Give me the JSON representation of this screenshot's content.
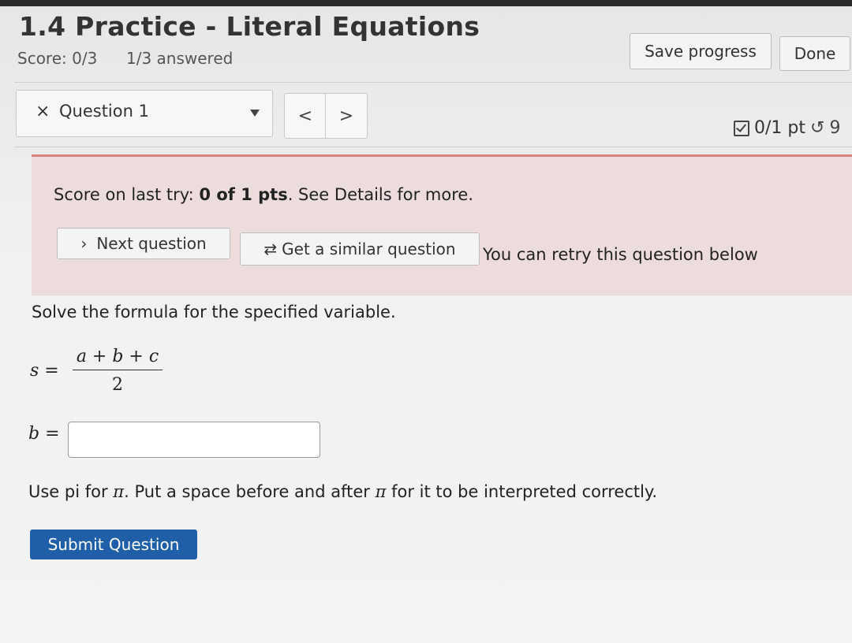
{
  "header": {
    "title": "1.4 Practice - Literal Equations",
    "score": "Score: 0/3",
    "answered": "1/3 answered",
    "save_label": "Save progress",
    "done_label": "Done"
  },
  "question_nav": {
    "close_glyph": "×",
    "current": "Question 1",
    "prev_glyph": "<",
    "next_glyph": ">",
    "points": "0/1 pt",
    "retry_glyph": "↺",
    "retry_count": "9"
  },
  "alert": {
    "prefix": "Score on last try: ",
    "score": "0 of 1 pts",
    "suffix": ". See Details for more.",
    "next_question_label": "Next question",
    "next_glyph": "›",
    "similar_label": "Get a similar question",
    "similar_glyph": "⇄",
    "retry_text": "You can retry this question below"
  },
  "problem": {
    "instruction": "Solve the formula for the specified variable.",
    "lhs": "s =",
    "numerator": "a + b + c",
    "denominator": "2",
    "answer_label": "b =",
    "answer_value": "",
    "hint_part1": "Use pi for ",
    "hint_pi": "π",
    "hint_part2": ". Put a space before and after ",
    "hint_part3": " for it to be interpreted correctly.",
    "submit_label": "Submit Question"
  },
  "colors": {
    "submit_bg": "#1f5fa8",
    "alert_bg": "#ecdcdc",
    "alert_border": "#d98080"
  }
}
